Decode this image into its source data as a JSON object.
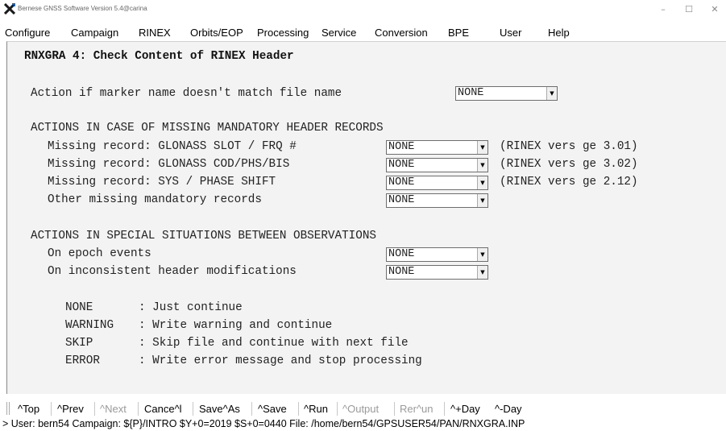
{
  "window": {
    "title": "Bernese GNSS Software Version 5.4@carina",
    "minimize_glyph": "–",
    "maximize_glyph": "☐",
    "close_glyph": "✕"
  },
  "menu": [
    {
      "label": "Configure"
    },
    {
      "label": "Campaign"
    },
    {
      "label": "RINEX"
    },
    {
      "label": "Orbits/EOP"
    },
    {
      "label": "Processing"
    },
    {
      "label": "Service"
    },
    {
      "label": "Conversion"
    },
    {
      "label": "BPE"
    },
    {
      "label": "User"
    },
    {
      "label": "Help"
    }
  ],
  "panel": {
    "title": "RNXGRA 4: Check Content of RINEX Header",
    "marker_label": "Action if marker name doesn't match file name",
    "marker_value": "NONE",
    "section1_heading": "ACTIONS IN CASE OF MISSING MANDATORY HEADER RECORDS",
    "missing_rows": [
      {
        "label": "Missing record: GLONASS SLOT / FRQ #",
        "value": "NONE",
        "note": "(RINEX vers ge 3.01)"
      },
      {
        "label": "Missing record: GLONASS COD/PHS/BIS",
        "value": "NONE",
        "note": "(RINEX vers ge 3.02)"
      },
      {
        "label": "Missing record: SYS / PHASE SHIFT",
        "value": "NONE",
        "note": "(RINEX vers ge 2.12)"
      },
      {
        "label": "Other missing mandatory records",
        "value": "NONE",
        "note": ""
      }
    ],
    "section2_heading": "ACTIONS IN SPECIAL SITUATIONS BETWEEN OBSERVATIONS",
    "special_rows": [
      {
        "label": "On epoch events",
        "value": "NONE"
      },
      {
        "label": "On inconsistent header modifications",
        "value": "NONE"
      }
    ],
    "legend": [
      {
        "key": "NONE   ",
        "desc": ": Just continue"
      },
      {
        "key": "WARNING",
        "desc": ": Write warning and continue"
      },
      {
        "key": "SKIP   ",
        "desc": ": Skip file and continue with next file"
      },
      {
        "key": "ERROR  ",
        "desc": ": Write error message and stop processing"
      }
    ],
    "dropdown_arrow": "▼"
  },
  "toolbar": {
    "buttons": [
      {
        "label": "^Top",
        "enabled": true
      },
      {
        "label": "^Prev",
        "enabled": true
      },
      {
        "label": "^Next",
        "enabled": false
      },
      {
        "label": "Cance^l",
        "enabled": true
      },
      {
        "label": "Save^As",
        "enabled": true
      },
      {
        "label": "^Save",
        "enabled": true
      },
      {
        "label": "^Run",
        "enabled": true
      },
      {
        "label": "^Output",
        "enabled": false
      },
      {
        "label": "Rer^un",
        "enabled": false
      },
      {
        "label": "^+Day",
        "enabled": true
      },
      {
        "label": "^-Day",
        "enabled": true
      }
    ]
  },
  "status": {
    "text": "> User: bern54  Campaign: ${P}/INTRO  $Y+0=2019  $S+0=0440  File: /home/bern54/GPSUSER54/PAN/RNXGRA.INP"
  },
  "colors": {
    "panel_bg": "#f3f3f3",
    "disabled_text": "#9a9a9a",
    "icon_blue": "#1f5fbf",
    "icon_dark": "#1a1a1a"
  }
}
